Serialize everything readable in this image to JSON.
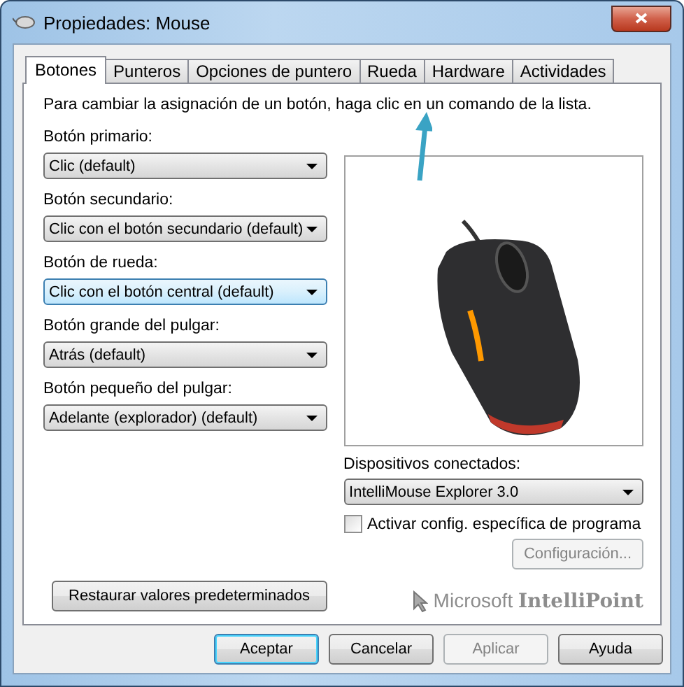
{
  "window": {
    "title": "Propiedades: Mouse"
  },
  "tabs": [
    {
      "label": "Botones",
      "selected": true
    },
    {
      "label": "Punteros",
      "selected": false
    },
    {
      "label": "Opciones de puntero",
      "selected": false
    },
    {
      "label": "Rueda",
      "selected": false
    },
    {
      "label": "Hardware",
      "selected": false
    },
    {
      "label": "Actividades",
      "selected": false
    }
  ],
  "instruction": "Para cambiar la asignación de un botón, haga clic en un comando de la lista.",
  "button_assignments": [
    {
      "label": "Botón primario:",
      "value": "Clic (default)",
      "focused": false
    },
    {
      "label": "Botón secundario:",
      "value": "Clic con el botón secundario (default)",
      "focused": false
    },
    {
      "label": "Botón de rueda:",
      "value": "Clic con el botón central (default)",
      "focused": true
    },
    {
      "label": "Botón grande del pulgar:",
      "value": "Atrás (default)",
      "focused": false
    },
    {
      "label": "Botón pequeño del pulgar:",
      "value": "Adelante (explorador) (default)",
      "focused": false
    }
  ],
  "restore_button": "Restaurar valores predeterminados",
  "devices": {
    "label": "Dispositivos conectados:",
    "value": "IntelliMouse Explorer 3.0"
  },
  "app_specific": {
    "label": "Activar config. específica de programa",
    "checked": false
  },
  "config_button": {
    "label": "Configuración...",
    "disabled": true
  },
  "brand": {
    "company": "Microsoft",
    "product": "IntelliPoint"
  },
  "dialog_buttons": [
    {
      "label": "Aceptar",
      "default": true,
      "disabled": false
    },
    {
      "label": "Cancelar",
      "default": false,
      "disabled": false
    },
    {
      "label": "Aplicar",
      "default": false,
      "disabled": true
    },
    {
      "label": "Ayuda",
      "default": false,
      "disabled": false
    }
  ]
}
